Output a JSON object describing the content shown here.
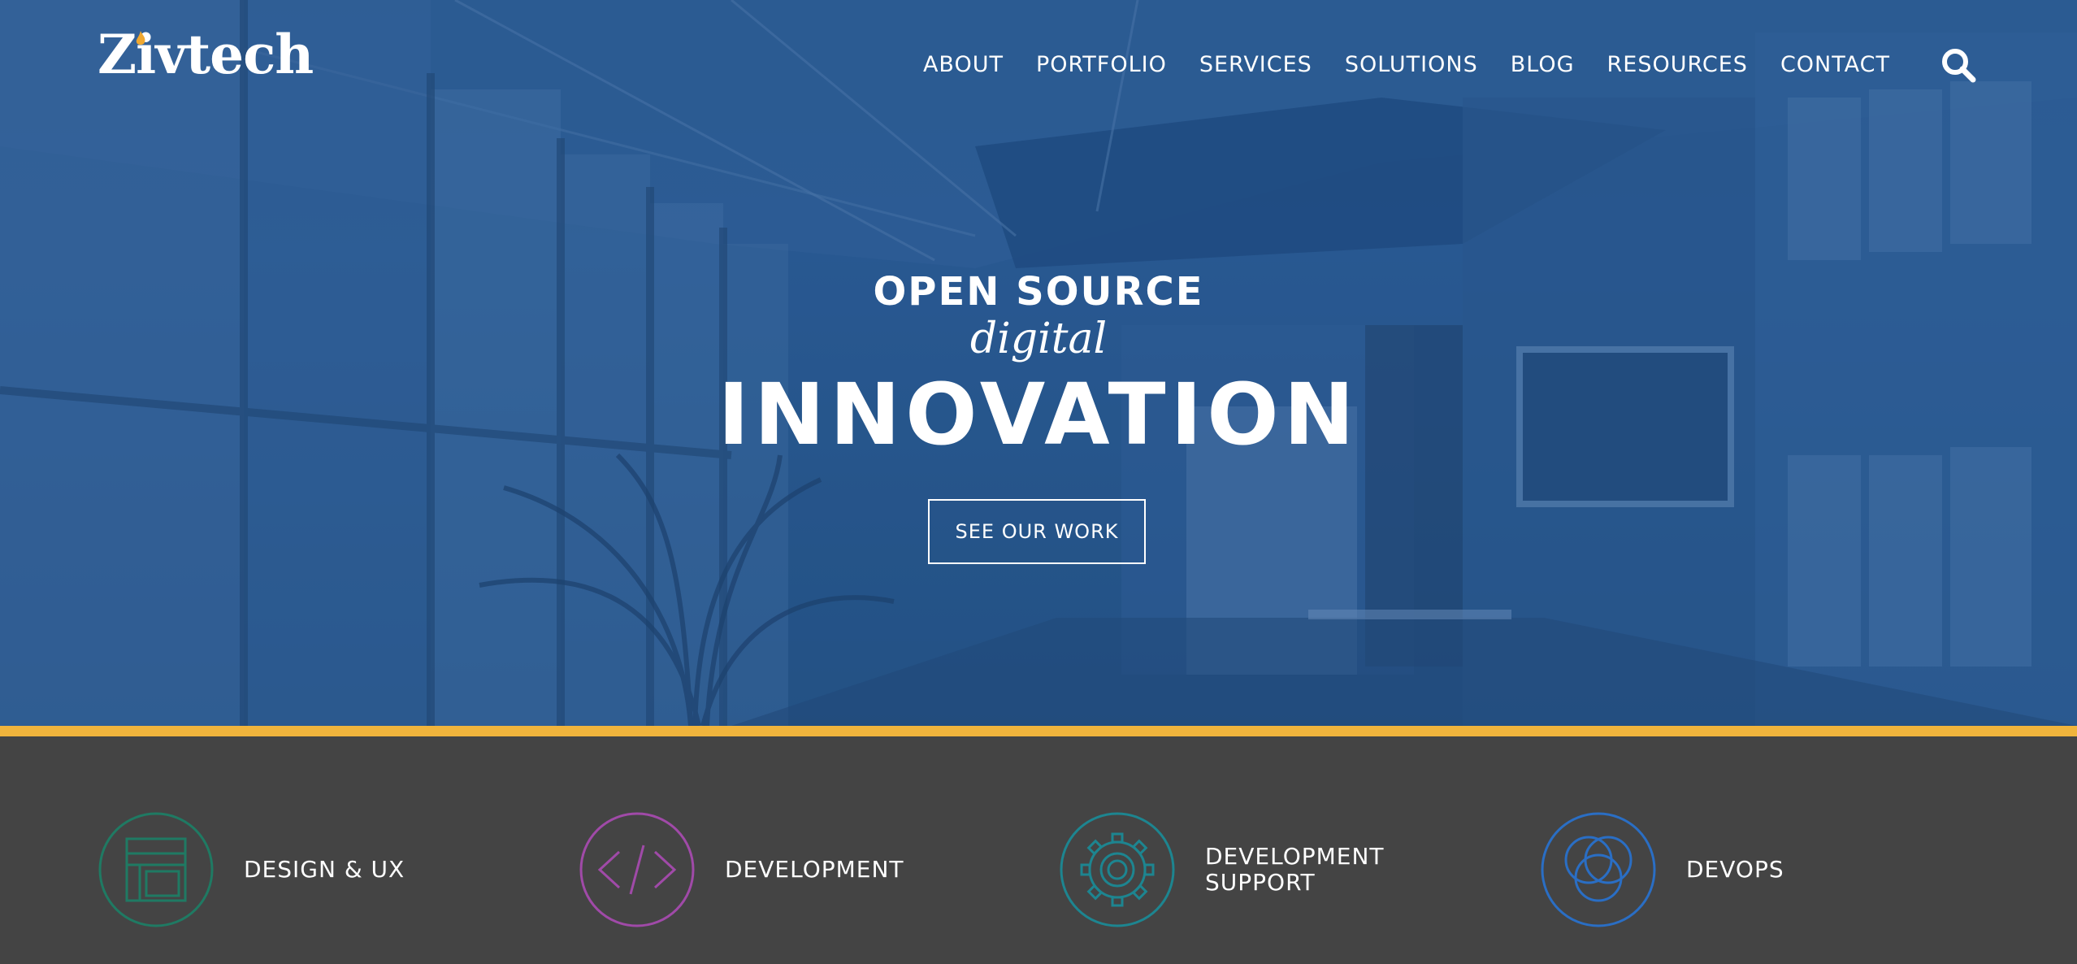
{
  "header": {
    "logo_text": "Zivtech",
    "nav": [
      {
        "label": "ABOUT"
      },
      {
        "label": "PORTFOLIO"
      },
      {
        "label": "SERVICES"
      },
      {
        "label": "SOLUTIONS"
      },
      {
        "label": "BLOG"
      },
      {
        "label": "RESOURCES"
      },
      {
        "label": "CONTACT"
      }
    ],
    "search_icon": "search-icon"
  },
  "hero": {
    "line1": "OPEN SOURCE",
    "line2": "digital",
    "line3": "INNOVATION",
    "cta_label": "SEE OUR WORK"
  },
  "services": [
    {
      "label": "DESIGN & UX",
      "icon": "layout-icon",
      "color": "#1f7a63"
    },
    {
      "label": "DEVELOPMENT",
      "icon": "code-icon",
      "color": "#a04aa8"
    },
    {
      "label": "DEVELOPMENT\nSUPPORT",
      "icon": "gear-icon",
      "color": "#1d8590"
    },
    {
      "label": "DEVOPS",
      "icon": "circles-icon",
      "color": "#2a6ec4"
    }
  ],
  "colors": {
    "hero_blue": "#2f609a",
    "accent_stripe": "#f0b43c",
    "services_bg": "#444444",
    "logo_flame": "#f0a830"
  }
}
